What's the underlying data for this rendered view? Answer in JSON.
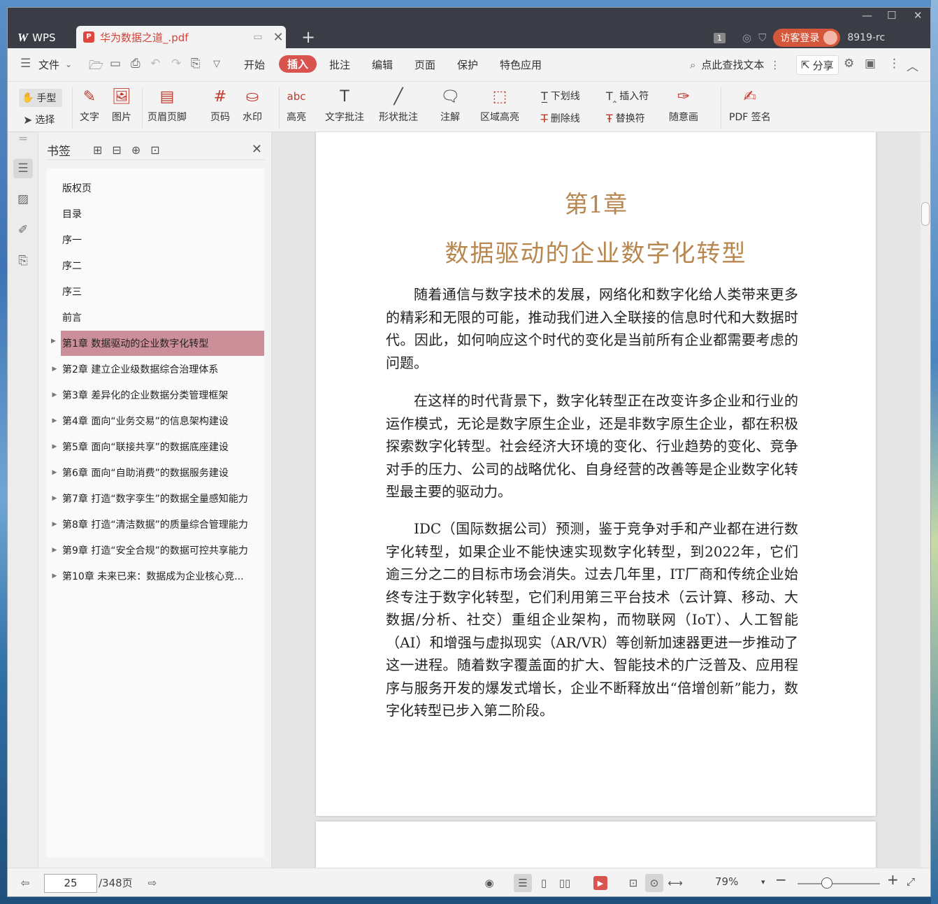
{
  "app": {
    "name": "WPS",
    "doc_tab": "华为数据之道_.pdf",
    "user_badge": "1",
    "login_label": "访客登录",
    "user_id": "8919-rc"
  },
  "menu": {
    "file": "文件",
    "items": [
      "开始",
      "插入",
      "批注",
      "编辑",
      "页面",
      "保护",
      "特色应用"
    ],
    "active": "插入",
    "search": "点此查找文本",
    "share": "分享"
  },
  "ribbon": {
    "hand": "手型",
    "select": "选择",
    "text": "文字",
    "image": "图片",
    "header_footer": "页眉页脚",
    "page_num": "页码",
    "watermark": "水印",
    "highlight": "高亮",
    "text_comment": "文字批注",
    "shape_comment": "形状批注",
    "note": "注解",
    "area_highlight": "区域高亮",
    "underline": "下划线",
    "strikethrough": "删除线",
    "insert_mark": "插入符",
    "replace_mark": "替换符",
    "freehand": "随意画",
    "pdf_sign": "PDF 签名"
  },
  "bookmarks": {
    "title": "书签",
    "items": [
      "版权页",
      "目录",
      "序一",
      "序二",
      "序三",
      "前言",
      "第1章 数据驱动的企业数字化转型",
      "第2章 建立企业级数据综合治理体系",
      "第3章 差异化的企业数据分类管理框架",
      "第4章 面向“业务交易”的信息架构建设",
      "第5章 面向“联接共享”的数据底座建设",
      "第6章 面向“自助消费”的数据服务建设",
      "第7章 打造“数字孪生”的数据全量感知能力",
      "第8章 打造“清洁数据”的质量综合管理能力",
      "第9章 打造“安全合规”的数据可控共享能力",
      "第10章 未来已来：数据成为企业核心竞..."
    ],
    "selected_index": 6
  },
  "document": {
    "chapter_number": "第1章",
    "chapter_title": "数据驱动的企业数字化转型",
    "paragraphs": [
      "随着通信与数字技术的发展，网络化和数字化给人类带来更多的精彩和无限的可能，推动我们进入全联接的信息时代和大数据时代。因此，如何响应这个时代的变化是当前所有企业都需要考虑的问题。",
      "在这样的时代背景下，数字化转型正在改变许多企业和行业的运作模式，无论是数字原生企业，还是非数字原生企业，都在积极探索数字化转型。社会经济大环境的变化、行业趋势的变化、竞争对手的压力、公司的战略优化、自身经营的改善等是企业数字化转型最主要的驱动力。",
      "IDC（国际数据公司）预测，鉴于竞争对手和产业都在进行数字化转型，如果企业不能快速实现数字化转型，到2022年，它们逾三分之二的目标市场会消失。过去几年里，IT厂商和传统企业始终专注于数字化转型，它们利用第三平台技术（云计算、移动、大数据/分析、社交）重组企业架构，而物联网（IoT）、人工智能（AI）和增强与虚拟现实（AR/VR）等创新加速器更进一步推动了这一进程。随着数字覆盖面的扩大、智能技术的广泛普及、应用程序与服务开发的爆发式增长，企业不断释放出“倍增创新”能力，数字化转型已步入第二阶段。"
    ]
  },
  "status": {
    "current_page": "25",
    "total_pages": "/348页",
    "zoom": "79%"
  }
}
